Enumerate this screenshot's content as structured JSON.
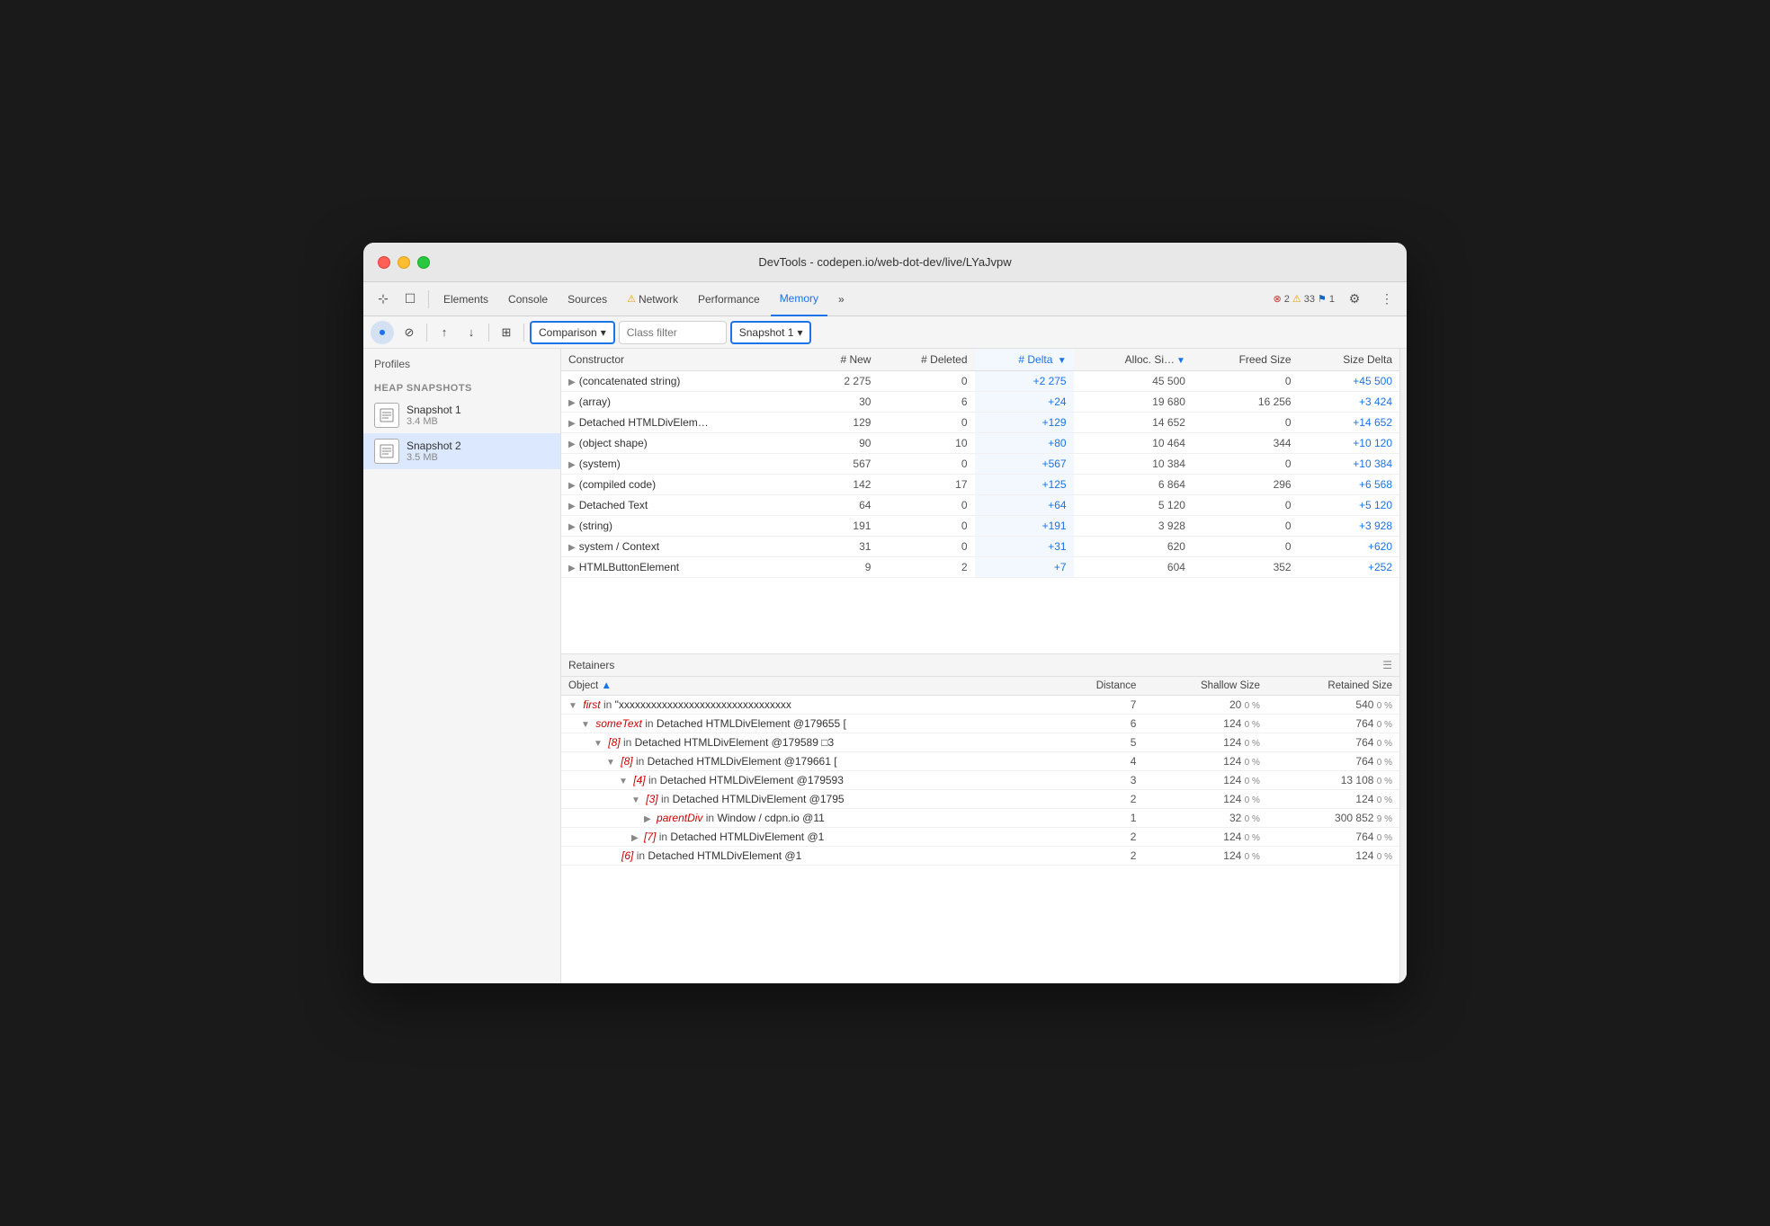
{
  "window": {
    "title": "DevTools - codepen.io/web-dot-dev/live/LYaJvpw"
  },
  "tabs": {
    "items": [
      {
        "label": "Elements",
        "active": false
      },
      {
        "label": "Console",
        "active": false
      },
      {
        "label": "Sources",
        "active": false
      },
      {
        "label": "⚠ Network",
        "active": false,
        "warning": true
      },
      {
        "label": "Performance",
        "active": false
      },
      {
        "label": "Memory",
        "active": true
      },
      {
        "label": "»",
        "active": false
      }
    ],
    "badges": {
      "errors": "2",
      "warnings": "33",
      "info": "1"
    }
  },
  "toolbar": {
    "comparison_label": "Comparison",
    "class_filter_placeholder": "Class filter",
    "snapshot_label": "Snapshot 1"
  },
  "sidebar": {
    "profiles_title": "Profiles",
    "heap_snapshots_title": "HEAP SNAPSHOTS",
    "snapshots": [
      {
        "name": "Snapshot 1",
        "size": "3.4 MB",
        "active": false
      },
      {
        "name": "Snapshot 2",
        "size": "3.5 MB",
        "active": true
      }
    ]
  },
  "table": {
    "headers": [
      "Constructor",
      "# New",
      "# Deleted",
      "# Delta",
      "Alloc. Si…",
      "Freed Size",
      "Size Delta"
    ],
    "rows": [
      {
        "constructor": "(concatenated string)",
        "new": "2 275",
        "deleted": "0",
        "delta": "+2 275",
        "alloc": "45 500",
        "freed": "0",
        "size_delta": "+45 500"
      },
      {
        "constructor": "(array)",
        "new": "30",
        "deleted": "6",
        "delta": "+24",
        "alloc": "19 680",
        "freed": "16 256",
        "size_delta": "+3 424"
      },
      {
        "constructor": "Detached HTMLDivElem…",
        "new": "129",
        "deleted": "0",
        "delta": "+129",
        "alloc": "14 652",
        "freed": "0",
        "size_delta": "+14 652"
      },
      {
        "constructor": "(object shape)",
        "new": "90",
        "deleted": "10",
        "delta": "+80",
        "alloc": "10 464",
        "freed": "344",
        "size_delta": "+10 120"
      },
      {
        "constructor": "(system)",
        "new": "567",
        "deleted": "0",
        "delta": "+567",
        "alloc": "10 384",
        "freed": "0",
        "size_delta": "+10 384"
      },
      {
        "constructor": "(compiled code)",
        "new": "142",
        "deleted": "17",
        "delta": "+125",
        "alloc": "6 864",
        "freed": "296",
        "size_delta": "+6 568"
      },
      {
        "constructor": "Detached Text",
        "new": "64",
        "deleted": "0",
        "delta": "+64",
        "alloc": "5 120",
        "freed": "0",
        "size_delta": "+5 120"
      },
      {
        "constructor": "(string)",
        "new": "191",
        "deleted": "0",
        "delta": "+191",
        "alloc": "3 928",
        "freed": "0",
        "size_delta": "+3 928"
      },
      {
        "constructor": "system / Context",
        "new": "31",
        "deleted": "0",
        "delta": "+31",
        "alloc": "620",
        "freed": "0",
        "size_delta": "+620"
      },
      {
        "constructor": "HTMLButtonElement",
        "new": "9",
        "deleted": "2",
        "delta": "+7",
        "alloc": "604",
        "freed": "352",
        "size_delta": "+252"
      }
    ]
  },
  "retainers": {
    "section_title": "Retainers",
    "headers": [
      "Object",
      "Distance",
      "Shallow Size",
      "Retained Size"
    ],
    "rows": [
      {
        "indent": 0,
        "object": "first",
        "in_text": " in ",
        "ref": "\"xxxxxxxxxxxxxxxxxxxxxxxxxxxxxxxx",
        "keyword": "",
        "distance": "7",
        "shallow": "20",
        "shallow_pct": "0 %",
        "retained": "540",
        "retained_pct": "0 %"
      },
      {
        "indent": 1,
        "object": "someText",
        "in_text": " in ",
        "ref": "Detached HTMLDivElement @179655 [",
        "keyword": "",
        "distance": "6",
        "shallow": "124",
        "shallow_pct": "0 %",
        "retained": "764",
        "retained_pct": "0 %"
      },
      {
        "indent": 2,
        "object": "[8]",
        "in_text": " in ",
        "ref": "Detached HTMLDivElement @179589 □3",
        "keyword": "",
        "distance": "5",
        "shallow": "124",
        "shallow_pct": "0 %",
        "retained": "764",
        "retained_pct": "0 %"
      },
      {
        "indent": 3,
        "object": "[8]",
        "in_text": " in ",
        "ref": "Detached HTMLDivElement @179661 [",
        "keyword": "",
        "distance": "4",
        "shallow": "124",
        "shallow_pct": "0 %",
        "retained": "764",
        "retained_pct": "0 %"
      },
      {
        "indent": 4,
        "object": "[4]",
        "in_text": " in ",
        "ref": "Detached HTMLDivElement @179593",
        "keyword": "",
        "distance": "3",
        "shallow": "124",
        "shallow_pct": "0 %",
        "retained": "13 108",
        "retained_pct": "0 %"
      },
      {
        "indent": 5,
        "object": "[3]",
        "in_text": " in ",
        "ref": "Detached HTMLDivElement @1795",
        "keyword": "",
        "distance": "2",
        "shallow": "124",
        "shallow_pct": "0 %",
        "retained": "124",
        "retained_pct": "0 %"
      },
      {
        "indent": 6,
        "object": "parentDiv",
        "in_text": " in ",
        "ref": "Window / cdpn.io @11",
        "keyword": "",
        "distance": "1",
        "shallow": "32",
        "shallow_pct": "0 %",
        "retained": "300 852",
        "retained_pct": "9 %"
      },
      {
        "indent": 5,
        "object": "[7]",
        "in_text": " in ",
        "ref": "Detached HTMLDivElement @1",
        "keyword": "",
        "distance": "2",
        "shallow": "124",
        "shallow_pct": "0 %",
        "retained": "764",
        "retained_pct": "0 %"
      },
      {
        "indent": 4,
        "object": "[6]",
        "in_text": " in ",
        "ref": "Detached HTMLDivElement @1",
        "keyword": "",
        "distance": "2",
        "shallow": "124",
        "shallow_pct": "0 %",
        "retained": "124",
        "retained_pct": "0 %"
      }
    ]
  }
}
